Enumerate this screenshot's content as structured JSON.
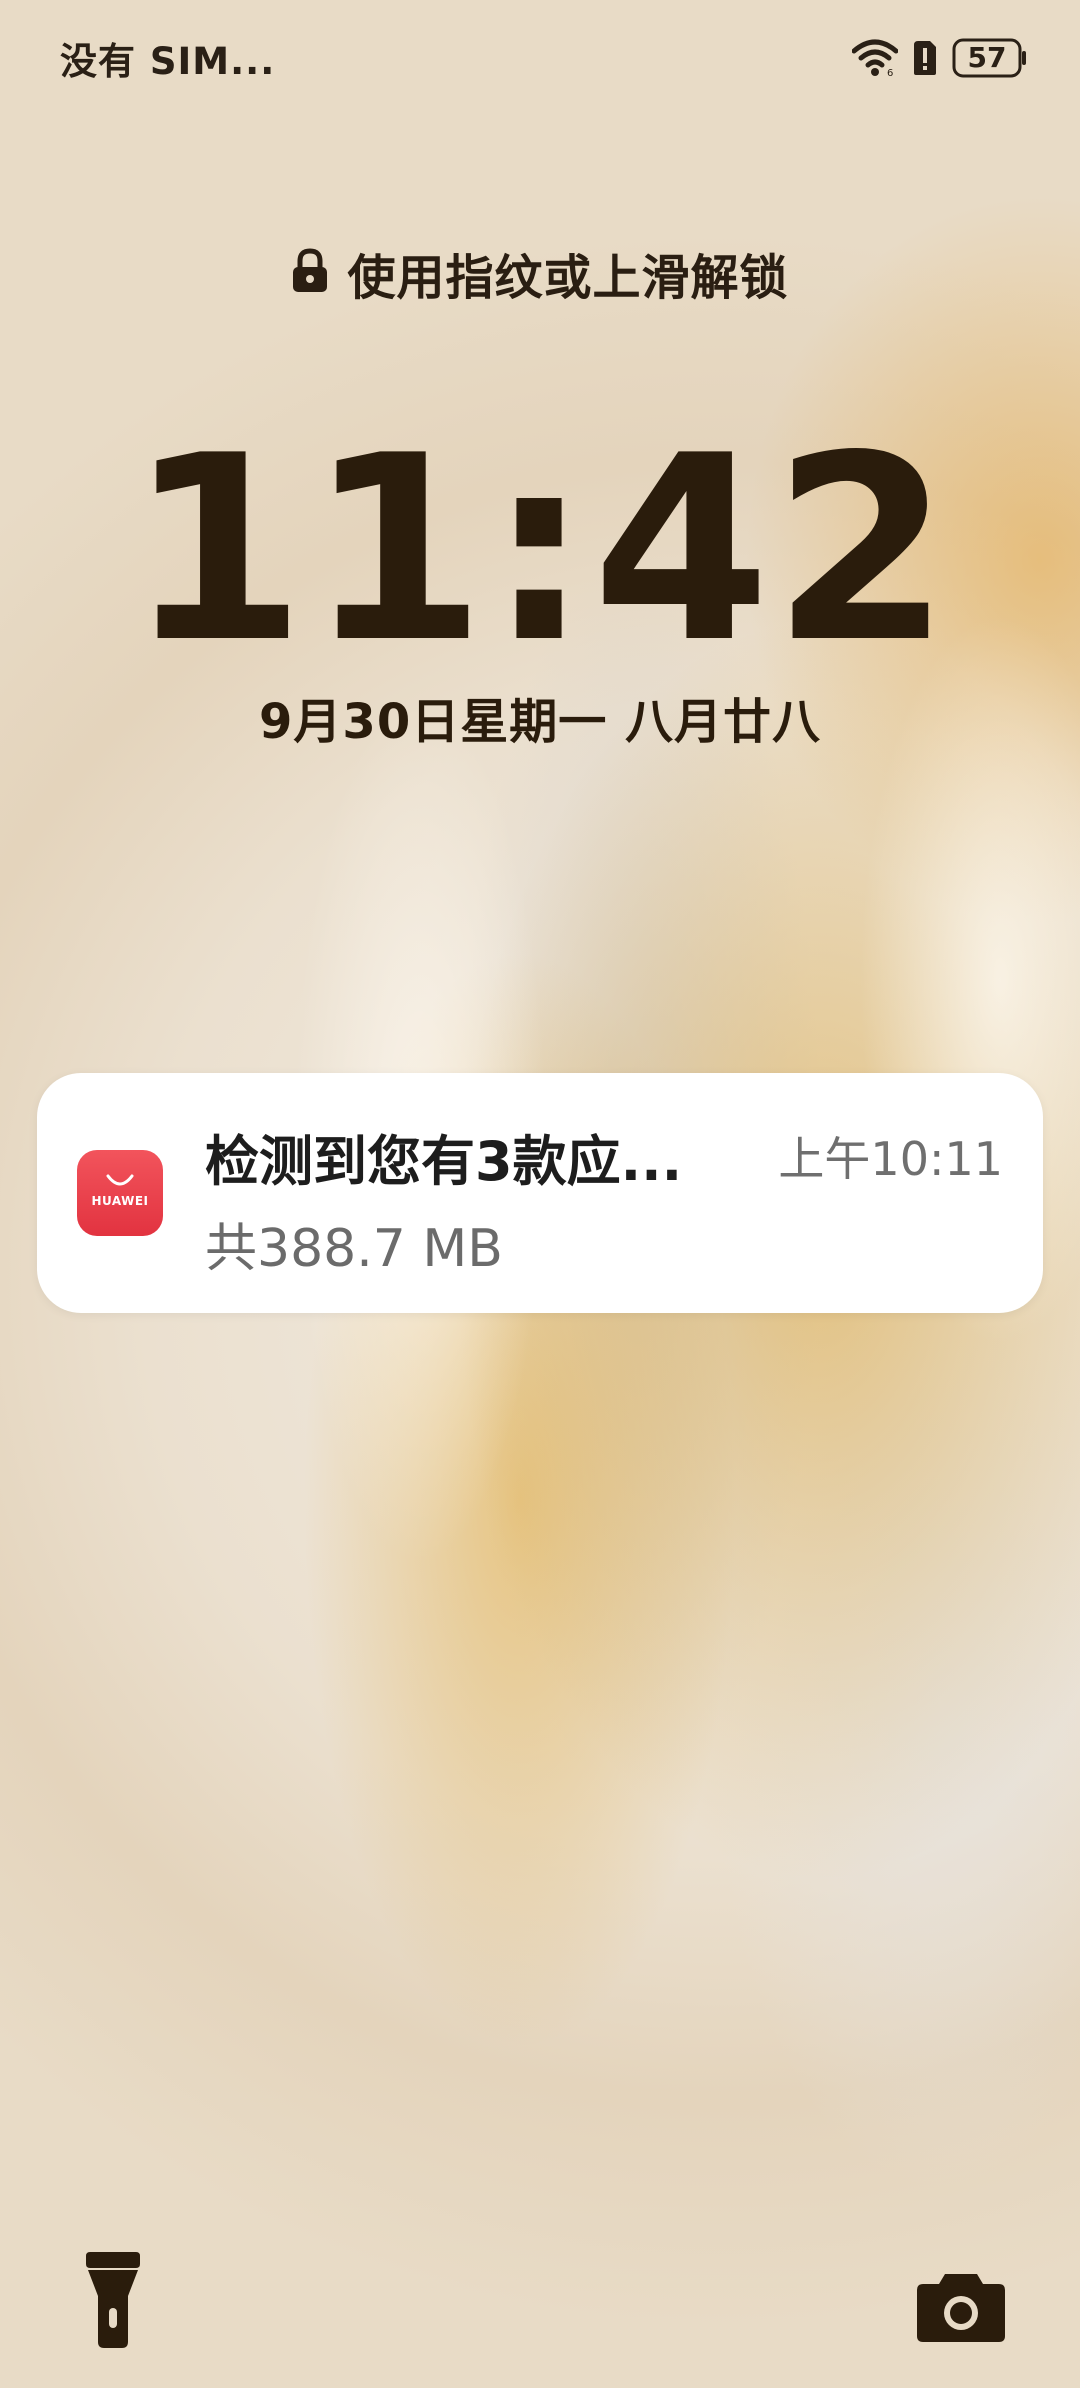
{
  "status_bar": {
    "carrier": "没有 SIM...",
    "battery_level": "57"
  },
  "lock_screen": {
    "unlock_hint": "使用指纹或上滑解锁",
    "time": "11:42",
    "date": "9月30日星期一 八月廿八"
  },
  "notification": {
    "app_icon_label": "HUAWEI",
    "title": "检测到您有3款应...",
    "time": "上午10:11",
    "subtitle": "共388.7 MB"
  },
  "icons": {
    "status": [
      "wifi-icon",
      "alert-icon",
      "battery-icon"
    ],
    "bottom": [
      "flashlight-icon",
      "camera-icon"
    ]
  },
  "colors": {
    "text_dark": "#2a1c0c",
    "notification_bg": "#ffffff",
    "app_icon_red": "#e23340"
  }
}
